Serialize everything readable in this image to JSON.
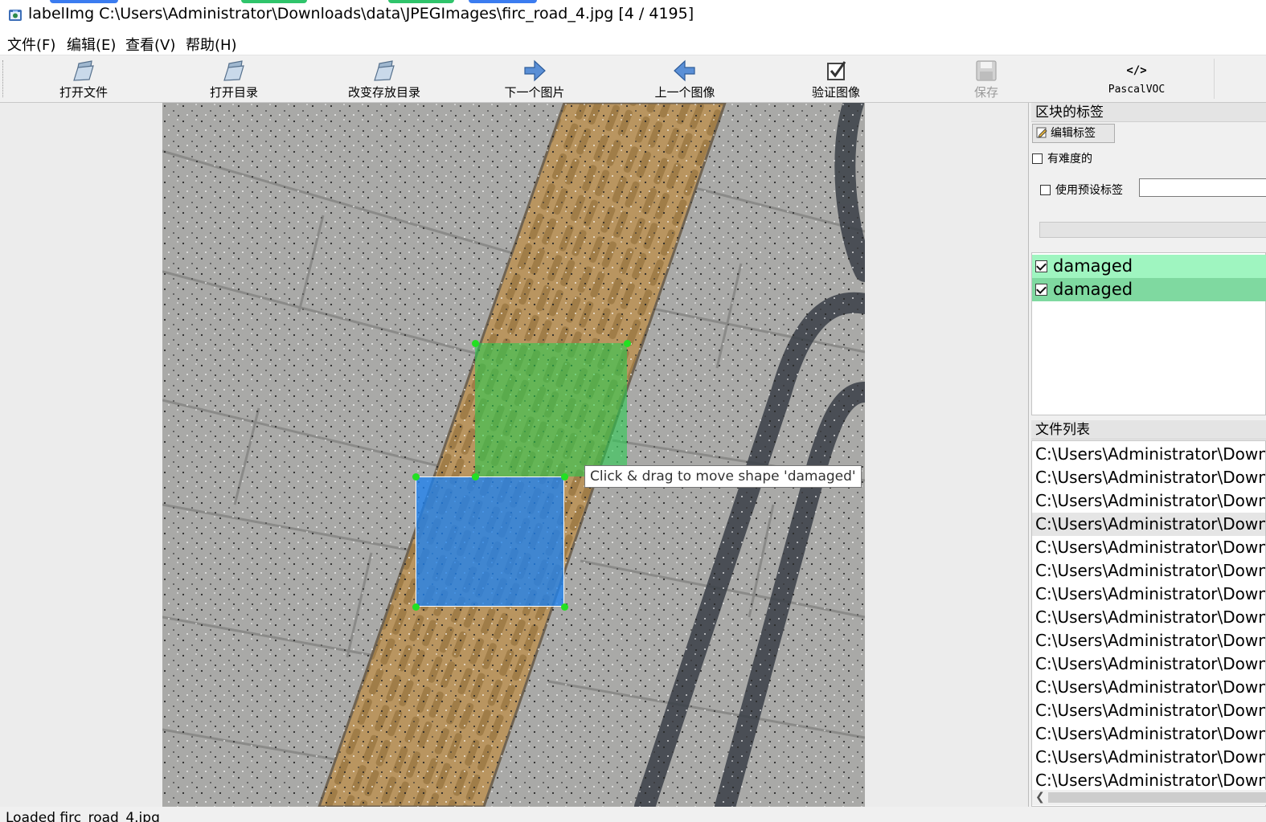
{
  "window": {
    "title": "labelImg C:\\Users\\Administrator\\Downloads\\data\\JPEGImages\\firc_road_4.jpg [4 / 4195]",
    "accent_colors": [
      "#3b7cf0",
      "#2fc46b",
      "#2fc46b",
      "#3b7cf0"
    ]
  },
  "menu": {
    "file": "文件(F)",
    "edit": "编辑(E)",
    "view": "查看(V)",
    "help": "帮助(H)"
  },
  "toolbar": {
    "open_file": "打开文件",
    "open_dir": "打开目录",
    "change_save_dir": "改变存放目录",
    "next_image": "下一个图片",
    "prev_image": "上一个图像",
    "verify_image": "验证图像",
    "save": "保存",
    "format": "PascalVOC",
    "format_icon_text": "</>"
  },
  "canvas": {
    "tooltip": "Click & drag to move shape 'damaged'",
    "shapes": [
      {
        "label": "damaged",
        "color": "#28cd50"
      },
      {
        "label": "damaged",
        "color": "#1e82f0"
      }
    ]
  },
  "label_panel": {
    "title": "区块的标签",
    "edit_label_button": "编辑标签",
    "difficult_checkbox": "有难度的",
    "use_default_label_checkbox": "使用预设标签",
    "default_label_value": "",
    "items": [
      {
        "text": "damaged",
        "checked": true,
        "bg": "#9ff5c0"
      },
      {
        "text": "damaged",
        "checked": true,
        "bg": "#7fd9a0"
      }
    ]
  },
  "file_panel": {
    "title": "文件列表",
    "selected_index": 3,
    "items": [
      "C:\\Users\\Administrator\\Down",
      "C:\\Users\\Administrator\\Down",
      "C:\\Users\\Administrator\\Down",
      "C:\\Users\\Administrator\\Down",
      "C:\\Users\\Administrator\\Down",
      "C:\\Users\\Administrator\\Down",
      "C:\\Users\\Administrator\\Down",
      "C:\\Users\\Administrator\\Down",
      "C:\\Users\\Administrator\\Down",
      "C:\\Users\\Administrator\\Down",
      "C:\\Users\\Administrator\\Down",
      "C:\\Users\\Administrator\\Down",
      "C:\\Users\\Administrator\\Down",
      "C:\\Users\\Administrator\\Down",
      "C:\\Users\\Administrator\\Down"
    ]
  },
  "status": {
    "text": "Loaded firc_road_4.jpg"
  }
}
